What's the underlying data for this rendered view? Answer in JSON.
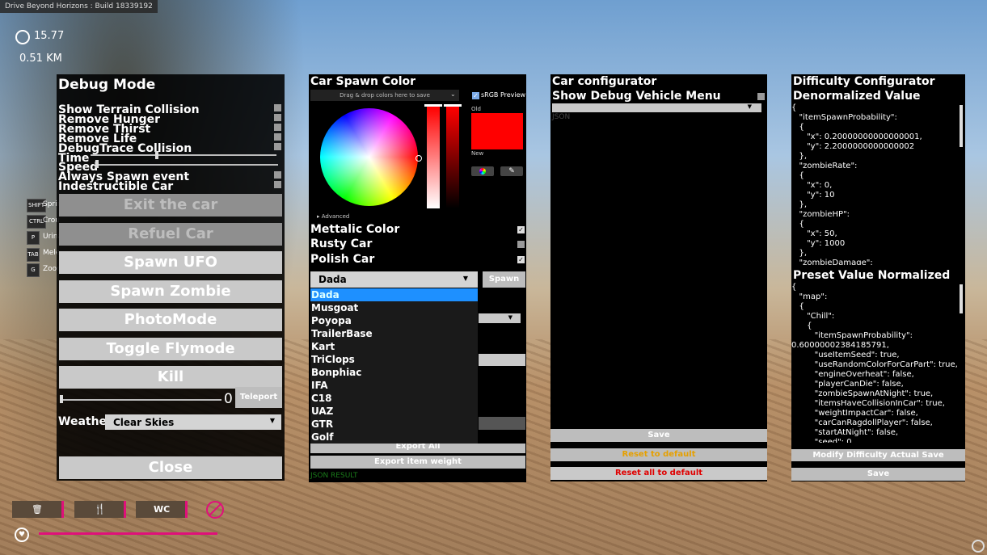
{
  "build_label": "Drive Beyond Horizons : Build 18339192",
  "hud": {
    "time": "15.77",
    "distance": "0.51 KM",
    "keys": [
      {
        "key": "SHIFT",
        "label": "Sprin"
      },
      {
        "key": "CTRL",
        "label": "Crou"
      },
      {
        "key": "P",
        "label": "Urina"
      },
      {
        "key": "TAB",
        "label": "Mele"
      },
      {
        "key": "G",
        "label": "Zoon"
      }
    ],
    "bottom_icons": [
      "trash-can",
      "fork-knife",
      "WC",
      "no-smoking"
    ],
    "wc_label": "WC",
    "health_fraction": 0.82
  },
  "debug": {
    "title": "Debug Mode",
    "toggles": [
      "Show Terrain Collision",
      "Remove Hunger",
      "Remove Thirst",
      "Remove Life",
      "DebugTrace Collision"
    ],
    "time_label": "Time",
    "speed_label": "Speed",
    "toggles2": [
      "Always Spawn event",
      "Indestructible Car"
    ],
    "buttons": [
      "Exit the car",
      "Refuel Car",
      "Spawn UFO",
      "Spawn Zombie",
      "PhotoMode",
      "Toggle Flymode",
      "Kill"
    ],
    "teleport_value": "0",
    "teleport_label": "Teleport",
    "weather_label": "Weather",
    "weather_value": "Clear Skies",
    "close_label": "Close"
  },
  "spawn": {
    "title": "Car Spawn Color",
    "drop_hint": "Drag & drop colors here to save",
    "srgb_label": "sRGB Preview",
    "old_label": "Old",
    "new_label": "New",
    "advanced_label": "Advanced",
    "selected_color": "#ff0000",
    "options": [
      {
        "label": "Mettalic Color",
        "checked": true
      },
      {
        "label": "Rusty Car",
        "checked": false
      },
      {
        "label": "Polish Car",
        "checked": true
      }
    ],
    "car_selected": "Dada",
    "spawn_label": "Spawn",
    "car_list": [
      "Dada",
      "Musgoat",
      "Poyopa",
      "TrailerBase",
      "Kart",
      "TriClops",
      "Bonphiac",
      "IFA",
      "C18",
      "UAZ",
      "GTR",
      "Golf"
    ],
    "export_all_label": "Export All",
    "export_weight_label": "Export item weight",
    "json_result_label": "JSON RESULT"
  },
  "configurator": {
    "title": "Car configurator",
    "debug_menu_label": "Show Debug Vehicle Menu",
    "json_label": "JSON",
    "save_label": "Save",
    "reset_label": "Reset to default",
    "reset_all_label": "Reset all to default"
  },
  "difficulty": {
    "title": "Difficulty Configurator",
    "denorm_title": "Denormalized Value",
    "denorm_json": "{\n   \"itemSpawnProbability\":\n   {\n      \"x\": 0.20000000000000001,\n      \"y\": 2.2000000000000002\n   },\n   \"zombieRate\":\n   {\n      \"x\": 0,\n      \"y\": 10\n   },\n   \"zombieHP\":\n   {\n      \"x\": 50,\n      \"y\": 1000\n   },\n   \"zombieDamage\":",
    "preset_title": "Preset Value Normalized",
    "preset_json": "{\n   \"map\":\n   {\n      \"Chill\":\n      {\n         \"itemSpawnProbability\":\n0.60000002384185791,\n         \"useItemSeed\": true,\n         \"useRandomColorForCarPart\": true,\n         \"engineOverheat\": false,\n         \"playerCanDie\": false,\n         \"zombieSpawnAtNight\": true,\n         \"itemsHaveCollisionInCar\": true,\n         \"weightImpactCar\": false,\n         \"carCanRagdollPlayer\": false,\n         \"startAtNight\": false,\n         \"seed\": 0,",
    "modify_label": "Modify Difficulty Actual Save",
    "save_label": "Save"
  }
}
